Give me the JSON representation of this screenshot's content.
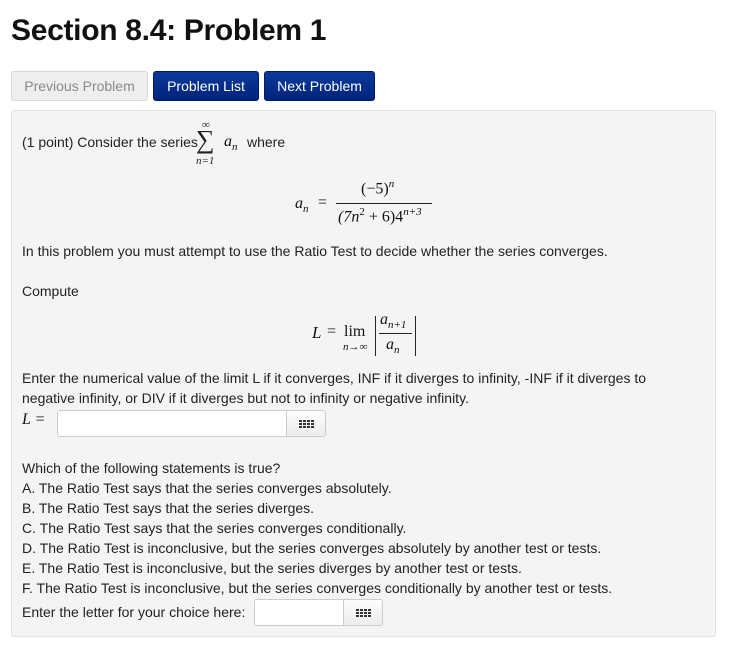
{
  "page": {
    "title": "Section 8.4: Problem 1"
  },
  "nav": {
    "previous_label": "Previous Problem",
    "list_label": "Problem List",
    "next_label": "Next Problem"
  },
  "problem": {
    "intro_prefix": "(1 point) Consider the series",
    "intro_suffix": "where",
    "sum_upper": "∞",
    "sum_symbol": "∑",
    "sum_lower": "n=1",
    "term": "a",
    "term_sub": "n",
    "definition": {
      "lhs": "a",
      "lhs_sub": "n",
      "equals": "=",
      "numerator": "(−5)",
      "numerator_exp": "n",
      "denominator_a": "(7n",
      "denominator_a_exp": "2",
      "denominator_b": " + 6)4",
      "denominator_b_exp": "n+3"
    },
    "instruction": "In this problem you must attempt to use the Ratio Test to decide whether the series converges.",
    "compute_label": "Compute",
    "limit": {
      "lhs": "L",
      "equals": "=",
      "lim": "lim",
      "lim_sub": "n→∞",
      "num": "a",
      "num_sub": "n+1",
      "den": "a",
      "den_sub": "n"
    },
    "limit_instruction_line1": "Enter the numerical value of the limit L if it converges, INF if it diverges to infinity, -INF if it diverges to",
    "limit_instruction_line2": "negative infinity, or DIV if it diverges but not to infinity or negative infinity.",
    "answer1_label": "L =",
    "answer1_value": "",
    "question": "Which of the following statements is true?",
    "options": [
      "A. The Ratio Test says that the series converges absolutely.",
      "B. The Ratio Test says that the series diverges.",
      "C. The Ratio Test says that the series converges conditionally.",
      "D. The Ratio Test is inconclusive, but the series converges absolutely by another test or tests.",
      "E. The Ratio Test is inconclusive, but the series diverges by another test or tests.",
      "F. The Ratio Test is inconclusive, but the series converges conditionally by another test or tests."
    ],
    "answer2_label": "Enter the letter for your choice here:",
    "answer2_value": "",
    "keypad_icon": "grid-keypad-icon"
  }
}
